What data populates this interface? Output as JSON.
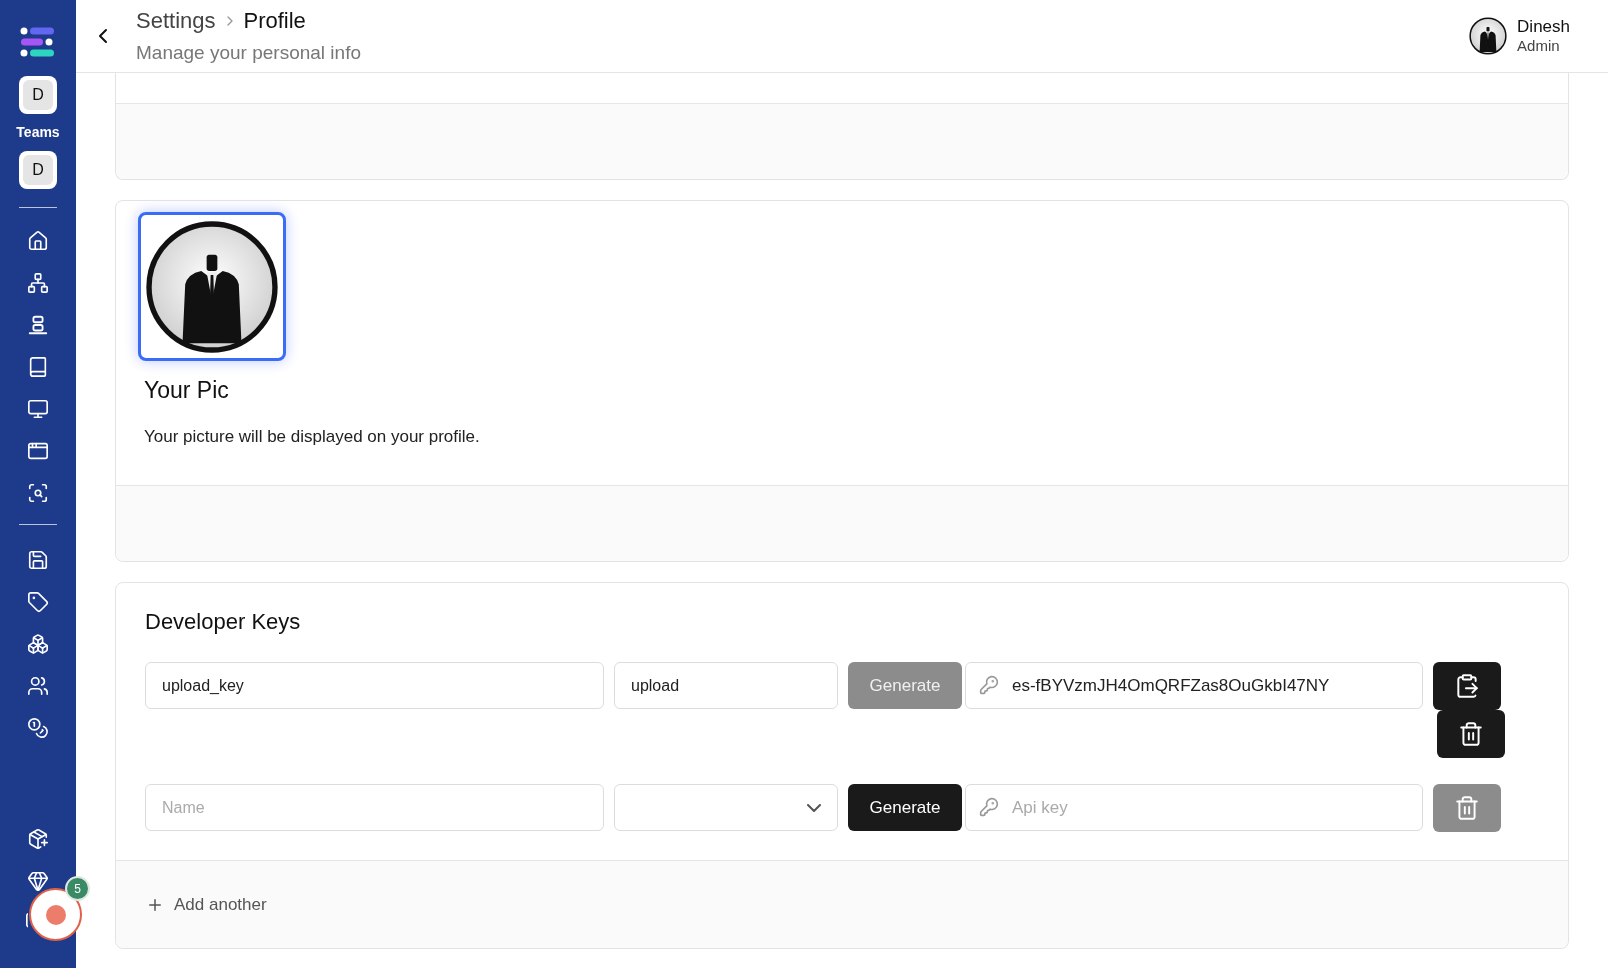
{
  "header": {
    "breadcrumb": [
      "Settings",
      "Profile"
    ],
    "subtitle": "Manage your personal info"
  },
  "user": {
    "name": "Dinesh",
    "role": "Admin"
  },
  "sidebar": {
    "teams_label": "Teams",
    "teams": [
      "D",
      "D"
    ],
    "notification_count": "5"
  },
  "profile_pic": {
    "title": "Your Pic",
    "description": "Your picture will be displayed on your profile."
  },
  "developer_keys": {
    "title": "Developer Keys",
    "add_label": "Add another",
    "rows": [
      {
        "name": {
          "value": "upload_key"
        },
        "permission": {
          "kind": "text",
          "value": "upload"
        },
        "generate": {
          "label": "Generate",
          "disabled": true
        },
        "key": {
          "value": "es-fBYVzmJH4OmQRFZas8OuGkbI47NY"
        },
        "copyable": true,
        "delete_disabled": false
      },
      {
        "name": {
          "placeholder": "Name"
        },
        "permission": {
          "kind": "select"
        },
        "generate": {
          "label": "Generate",
          "disabled": false
        },
        "key": {
          "placeholder": "Api key"
        },
        "copyable": false,
        "delete_disabled": true
      }
    ]
  }
}
